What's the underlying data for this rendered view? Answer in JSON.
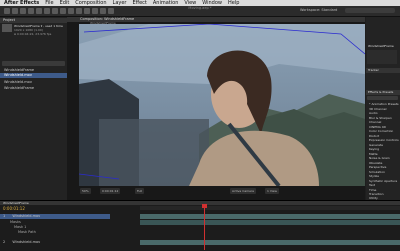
{
  "menubar": {
    "app": "After Effects",
    "items": [
      "File",
      "Edit",
      "Composition",
      "Layer",
      "Effect",
      "Animation",
      "View",
      "Window",
      "Help"
    ]
  },
  "window_title": "Moving.aep *",
  "workspace": {
    "label": "Workspace: Standard"
  },
  "project_panel": {
    "tab": "Project",
    "footage_name": "WindshieldFrame ▾ , used 1 time",
    "footage_info": [
      "1920 x 1080 (1.00)",
      "Δ 0:00:04:22, 23.976 fps"
    ],
    "items": [
      {
        "name": "WindshieldFrame",
        "selected": false
      },
      {
        "name": "Windshield.mov",
        "selected": true
      },
      {
        "name": "Windshield.mov",
        "selected": false
      },
      {
        "name": "WindshieldFrame",
        "selected": false
      }
    ]
  },
  "comp_panel": {
    "tab": "Composition: WindshieldFrame",
    "sub_tab": "WindshieldFrame",
    "controls": [
      "50%",
      "0:00:01:12",
      "Full",
      "Active Camera",
      "1 View"
    ]
  },
  "right_panel": {
    "info_title": "WindshieldFrame",
    "tracker_title": "Tracker",
    "effects_title": "Effects & Presets",
    "effects": [
      "* Animation Presets",
      "3D Channel",
      "Audio",
      "Blur & Sharpen",
      "Channel",
      "CINEMA 4D",
      "Color Correction",
      "Distort",
      "Expression Controls",
      "Generate",
      "Keying",
      "Matte",
      "Noise & Grain",
      "Obsolete",
      "Perspective",
      "Simulation",
      "Stylize",
      "Synthetic Aperture",
      "Text",
      "Time",
      "Transition",
      "Utility"
    ]
  },
  "timeline": {
    "tab": "WindshieldFrame",
    "timecode": "0:00:01:12",
    "layers": [
      {
        "num": "1",
        "name": "Windshield.mov",
        "selected": true
      },
      {
        "num": "2",
        "name": "Windshield.mov",
        "selected": false
      }
    ],
    "sub_rows": [
      "Masks",
      "Mask 1",
      "Mask Path"
    ]
  },
  "colors": {
    "accent": "#3e5b8a",
    "playhead": "#d03030",
    "mask": "#2a2ad0",
    "layer_bar": "#4a6a6a"
  }
}
